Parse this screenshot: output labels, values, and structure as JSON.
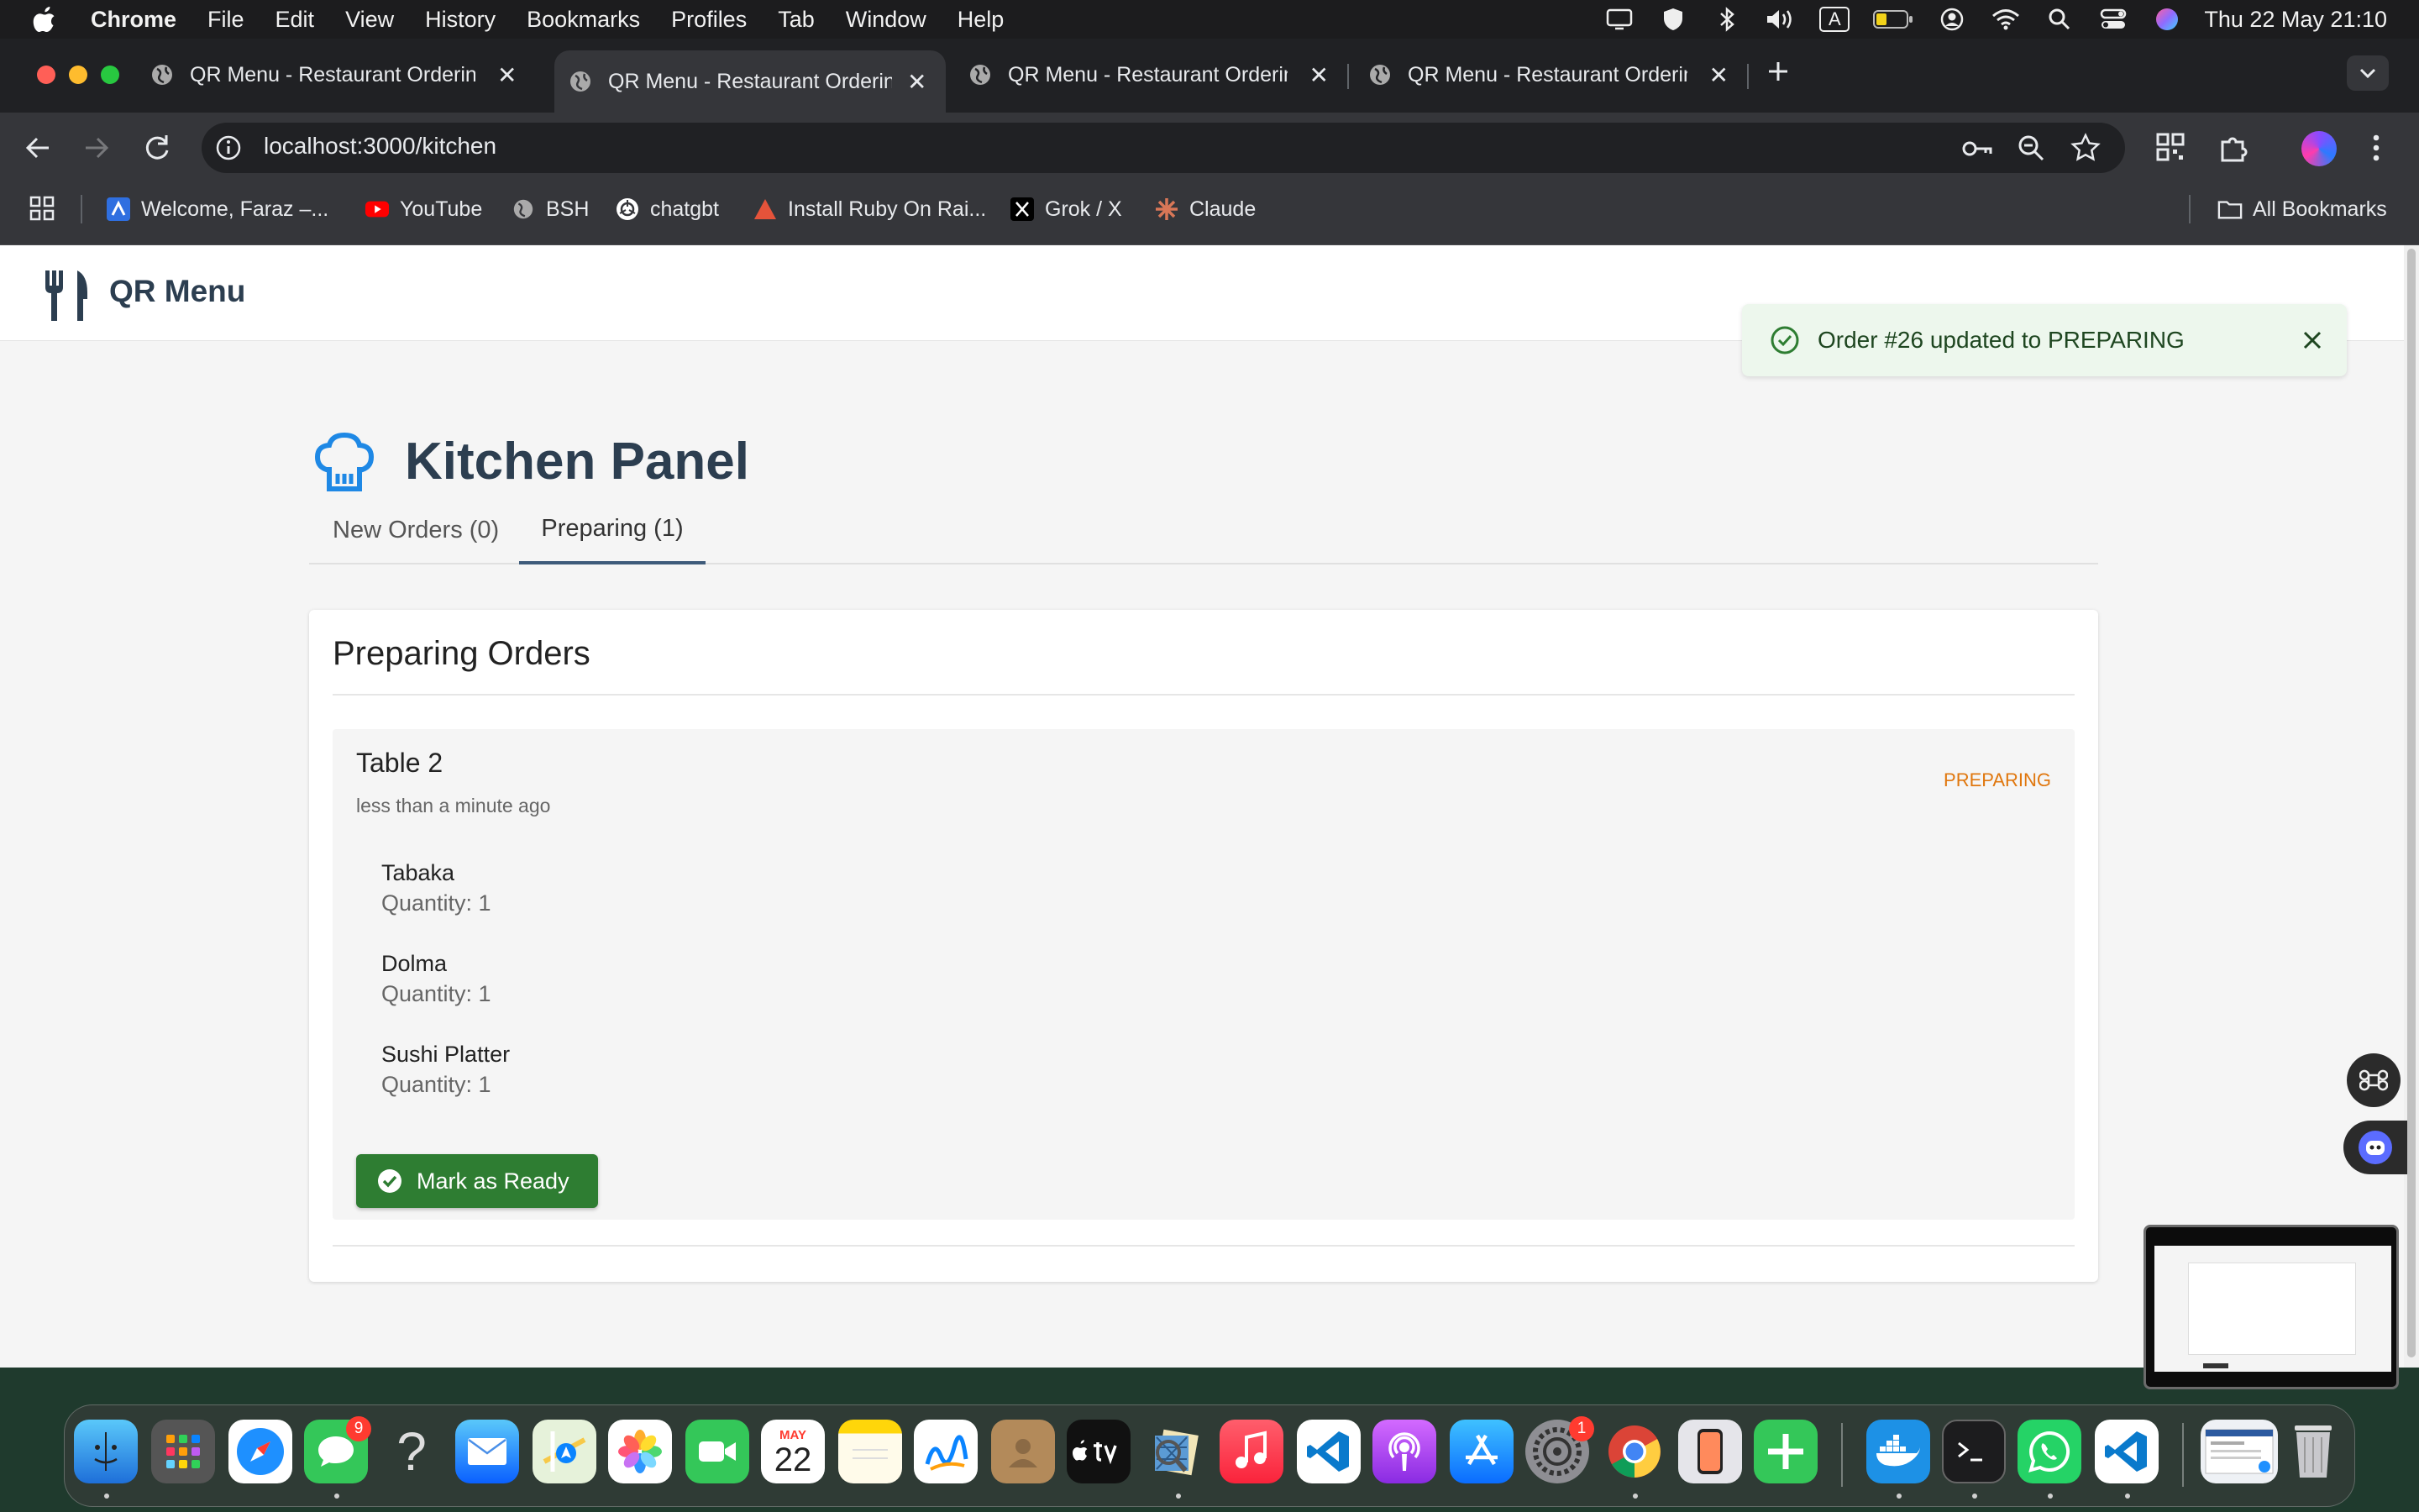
{
  "menubar": {
    "app": "Chrome",
    "items": [
      "File",
      "Edit",
      "View",
      "History",
      "Bookmarks",
      "Profiles",
      "Tab",
      "Window",
      "Help"
    ],
    "clock": "Thu 22 May  21:10",
    "status_icons": [
      "display-icon",
      "shield-icon",
      "bluetooth-icon",
      "volume-icon",
      "input-source-icon",
      "battery-icon",
      "user-icon",
      "wifi-icon",
      "spotlight-icon",
      "control-center-icon",
      "siri-icon"
    ],
    "input_source_label": "A"
  },
  "browser": {
    "tabs": [
      {
        "title": "QR Menu - Restaurant Ordering",
        "active": false
      },
      {
        "title": "QR Menu - Restaurant Ordering",
        "active": true
      },
      {
        "title": "QR Menu - Restaurant Ordering",
        "active": false
      },
      {
        "title": "QR Menu - Restaurant Ordering",
        "active": false
      }
    ],
    "url": "localhost:3000/kitchen",
    "bookmarks": [
      "Welcome, Faraz –...",
      "YouTube",
      "BSH",
      "chatgbt",
      "Install Ruby On Rai...",
      "Grok / X",
      "Claude"
    ],
    "all_bookmarks": "All Bookmarks"
  },
  "app": {
    "brand": "QR Menu",
    "toast": "Order #26 updated to PREPARING",
    "title": "Kitchen Panel",
    "tabs": [
      {
        "label": "New Orders (0)",
        "selected": false
      },
      {
        "label": "Preparing (1)",
        "selected": true
      }
    ],
    "section_title": "Preparing Orders",
    "order": {
      "table": "Table 2",
      "time": "less than a minute ago",
      "status": "PREPARING",
      "items": [
        {
          "name": "Tabaka",
          "quantity": "Quantity: 1"
        },
        {
          "name": "Dolma",
          "quantity": "Quantity: 1"
        },
        {
          "name": "Sushi Platter",
          "quantity": "Quantity: 1"
        }
      ],
      "action": "Mark as Ready"
    }
  },
  "dock": {
    "messages_badge": "9",
    "calendar_month": "MAY",
    "calendar_day": "22",
    "settings_badge": "1"
  },
  "colors": {
    "accent_blue": "#1e88e5",
    "success_green": "#2e7d32",
    "status_orange": "#e0770e",
    "heading": "#2c3e50"
  }
}
